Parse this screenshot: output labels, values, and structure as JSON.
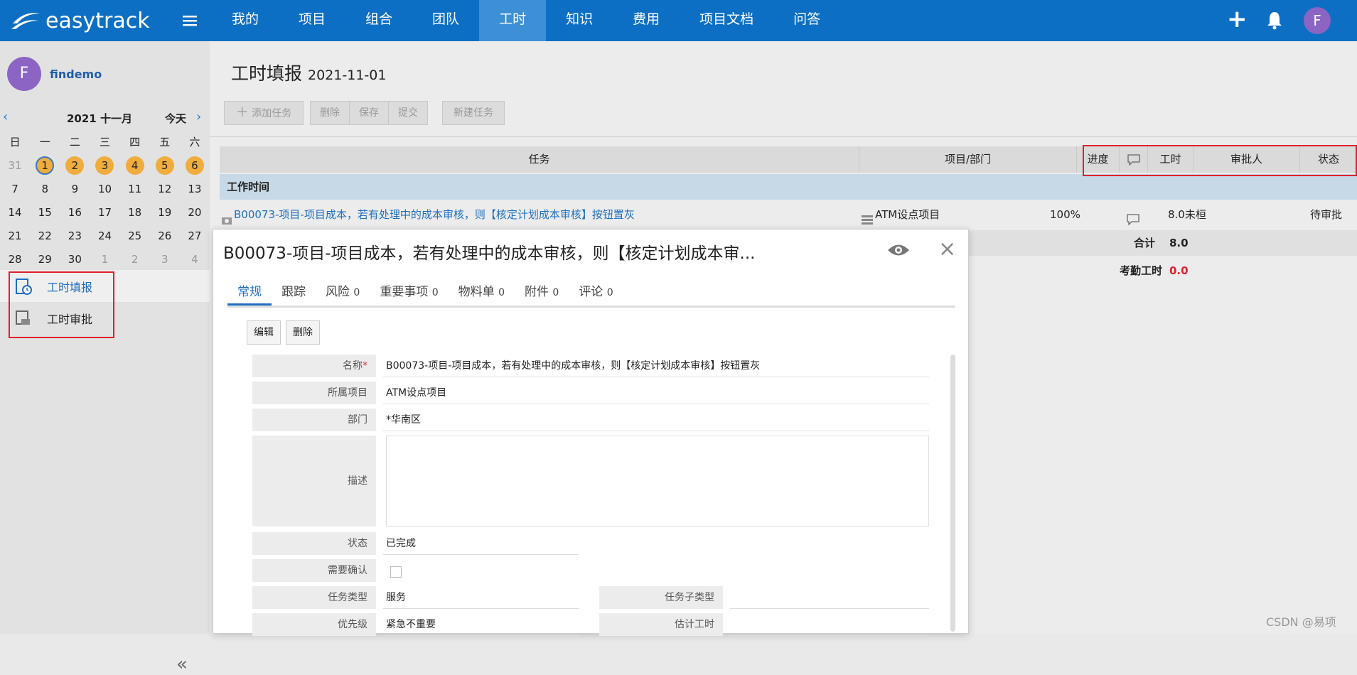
{
  "app": {
    "brand": "easytrack",
    "user_initial": "F"
  },
  "nav": {
    "items": [
      "我的",
      "项目",
      "组合",
      "团队",
      "工时",
      "知识",
      "费用",
      "项目文档",
      "问答"
    ],
    "active": "工时"
  },
  "sidebar": {
    "user_initial": "F",
    "user_name": "findemo",
    "calendar": {
      "title": "2021 十一月",
      "today_label": "今天",
      "weekdays": [
        "日",
        "一",
        "二",
        "三",
        "四",
        "五",
        "六"
      ],
      "rows": [
        [
          "31",
          "1",
          "2",
          "3",
          "4",
          "5",
          "6"
        ],
        [
          "7",
          "8",
          "9",
          "10",
          "11",
          "12",
          "13"
        ],
        [
          "14",
          "15",
          "16",
          "17",
          "18",
          "19",
          "20"
        ],
        [
          "21",
          "22",
          "23",
          "24",
          "25",
          "26",
          "27"
        ],
        [
          "28",
          "29",
          "30",
          "1",
          "2",
          "3",
          "4"
        ]
      ]
    },
    "menu": [
      {
        "label": "工时填报",
        "active": true
      },
      {
        "label": "工时审批",
        "active": false
      }
    ]
  },
  "main": {
    "title": "工时填报",
    "date": "2021-11-01",
    "toolbar": {
      "add": "添加任务",
      "delete": "删除",
      "save": "保存",
      "submit": "提交",
      "new_task": "新建任务"
    },
    "table": {
      "headers": {
        "task": "任务",
        "project": "项目/部门",
        "progress": "进度",
        "hours": "工时",
        "approver": "审批人",
        "status": "状态"
      },
      "group": "工作时间",
      "row": {
        "task": "B00073-项目-项目成本，若有处理中的成本审核，则【核定计划成本审核】按钮置灰",
        "project": "ATM设点项目",
        "progress": "100%",
        "hours": "8.0未桓",
        "status": "待审批"
      },
      "total_label": "合计",
      "total_value": "8.0",
      "attendance_label": "考勤工时",
      "attendance_value": "0.0"
    }
  },
  "modal": {
    "title": "B00073-项目-项目成本，若有处理中的成本审核，则【核定计划成本审...",
    "tabs": [
      {
        "label": "常规",
        "count": ""
      },
      {
        "label": "跟踪",
        "count": ""
      },
      {
        "label": "风险",
        "count": "0"
      },
      {
        "label": "重要事项",
        "count": "0"
      },
      {
        "label": "物料单",
        "count": "0"
      },
      {
        "label": "附件",
        "count": "0"
      },
      {
        "label": "评论",
        "count": "0"
      }
    ],
    "buttons": {
      "edit": "编辑",
      "delete": "删除"
    },
    "fields": {
      "name_label": "名称",
      "name_value": "B00073-项目-项目成本，若有处理中的成本审核，则【核定计划成本审核】按钮置灰",
      "project_label": "所属项目",
      "project_value": "ATM设点项目",
      "dept_label": "部门",
      "dept_value": "*华南区",
      "desc_label": "描述",
      "status_label": "状态",
      "status_value": "已完成",
      "confirm_label": "需要确认",
      "type_label": "任务类型",
      "type_value": "服务",
      "subtype_label": "任务子类型",
      "priority_label": "优先级",
      "priority_value": "紧急不重要",
      "estimate_label": "估计工时"
    }
  },
  "watermark": "CSDN @易项",
  "colors": {
    "topbar": "#0d6fc4",
    "accent": "#1e6dbf",
    "highlight_box": "#e0202b",
    "avatar": "#8b64c4",
    "calendar_dot": "#f0ac3c"
  }
}
